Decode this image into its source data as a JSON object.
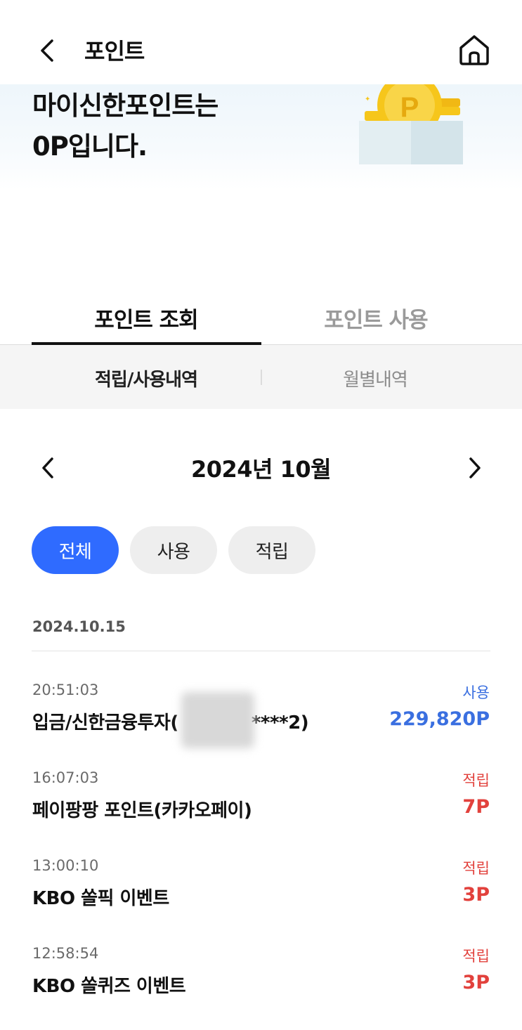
{
  "header": {
    "title": "포인트",
    "back_icon": "chevron-left-icon",
    "home_icon": "home-icon"
  },
  "banner": {
    "line1": "마이신한포인트는",
    "line2": "0P입니다.",
    "illustration": "coin-box-illustration",
    "coin_letter": "P"
  },
  "tabs": [
    {
      "label": "포인트 조회",
      "active": true
    },
    {
      "label": "포인트 사용",
      "active": false
    }
  ],
  "subtabs": [
    {
      "label": "적립/사용내역",
      "active": true
    },
    {
      "label": "월별내역",
      "active": false
    }
  ],
  "month": {
    "label": "2024년 10월",
    "prev_icon": "chevron-left-icon",
    "next_icon": "chevron-right-icon"
  },
  "filters": [
    {
      "label": "전체",
      "active": true
    },
    {
      "label": "사용",
      "active": false
    },
    {
      "label": "적립",
      "active": false
    }
  ],
  "date_group": "2024.10.15",
  "transactions": [
    {
      "time": "20:51:03",
      "type": "사용",
      "desc_prefix": "입금/신한금융투자(",
      "desc_suffix": "****2)",
      "amount": "229,820P",
      "kind": "use"
    },
    {
      "time": "16:07:03",
      "type": "적립",
      "desc": "페이팡팡 포인트(카카오페이)",
      "amount": "7P",
      "kind": "earn"
    },
    {
      "time": "13:00:10",
      "type": "적립",
      "desc": "KBO 쏠픽 이벤트",
      "amount": "3P",
      "kind": "earn"
    },
    {
      "time": "12:58:54",
      "type": "적립",
      "desc": "KBO 쏠퀴즈 이벤트",
      "amount": "3P",
      "kind": "earn"
    }
  ],
  "colors": {
    "accent": "#2f6bff",
    "use": "#3a6fe0",
    "earn": "#e2413c",
    "coin": "#f6c61b"
  }
}
